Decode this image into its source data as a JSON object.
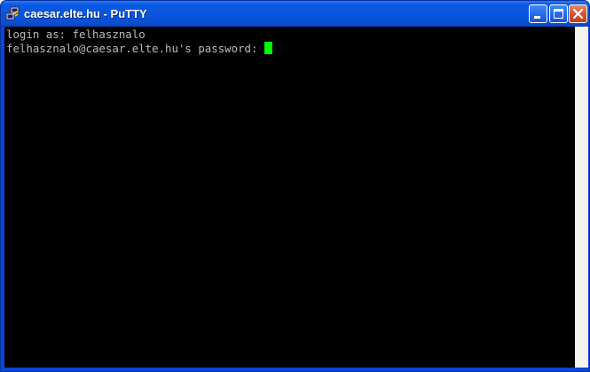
{
  "window": {
    "title": "caesar.elte.hu - PuTTY",
    "app_icon": "putty-icon",
    "controls": {
      "minimize_icon": "minimize-icon",
      "maximize_icon": "maximize-icon",
      "close_icon": "close-icon"
    }
  },
  "terminal": {
    "lines": [
      "login as: felhasznalo",
      "felhasznalo@caesar.elte.hu's password: "
    ],
    "cursor_color": "#00ff00",
    "text_color": "#bbbbbb",
    "background_color": "#000000"
  },
  "colors": {
    "titlebar": "#0a4fd2",
    "frame": "#0a46d8",
    "close_button": "#d9532f"
  }
}
